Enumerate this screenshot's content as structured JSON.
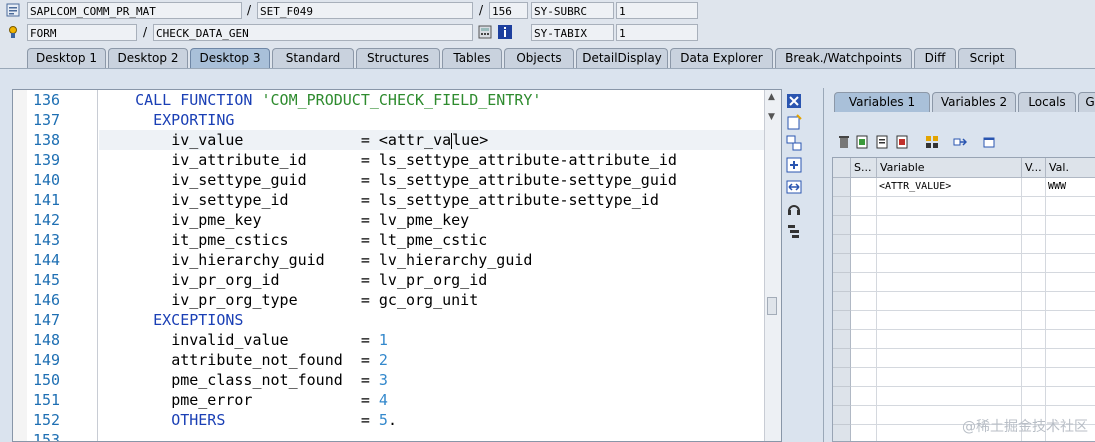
{
  "header": {
    "row1": {
      "program": "SAPLCOM_COMM_PR_MAT",
      "include": "SET_F049",
      "line": "156",
      "var1_name": "SY-SUBRC",
      "var1_value": "1"
    },
    "row2": {
      "event_type": "FORM",
      "event_name": "CHECK_DATA_GEN",
      "var2_name": "SY-TABIX",
      "var2_value": "1"
    },
    "separator": "/"
  },
  "tabs": [
    "Desktop 1",
    "Desktop 2",
    "Desktop 3",
    "Standard",
    "Structures",
    "Tables",
    "Objects",
    "DetailDisplay",
    "Data Explorer",
    "Break./Watchpoints",
    "Diff",
    "Script"
  ],
  "active_tab": "Desktop 3",
  "code": {
    "current_line": "138",
    "lines": [
      {
        "n": "136",
        "parts": [
          {
            "t": "CALL FUNCTION ",
            "c": "kw"
          },
          {
            "t": "'COM_PRODUCT_CHECK_FIELD_ENTRY'",
            "c": "str"
          }
        ],
        "indent": "  "
      },
      {
        "n": "137",
        "parts": [
          {
            "t": "EXPORTING",
            "c": "kw"
          }
        ],
        "indent": "    "
      },
      {
        "n": "138",
        "parts": [
          {
            "t": "iv_value             = <attr_va",
            "c": ""
          },
          {
            "t": "|",
            "c": "cursor"
          },
          {
            "t": "lue>",
            "c": ""
          }
        ],
        "indent": "      "
      },
      {
        "n": "139",
        "parts": [
          {
            "t": "iv_attribute_id      = ls_settype_attribute-attribute_id",
            "c": ""
          }
        ],
        "indent": "      "
      },
      {
        "n": "140",
        "parts": [
          {
            "t": "iv_settype_guid      = ls_settype_attribute-settype_guid",
            "c": ""
          }
        ],
        "indent": "      "
      },
      {
        "n": "141",
        "parts": [
          {
            "t": "iv_settype_id        = ls_settype_attribute-settype_id",
            "c": ""
          }
        ],
        "indent": "      "
      },
      {
        "n": "142",
        "parts": [
          {
            "t": "iv_pme_key           = lv_pme_key",
            "c": ""
          }
        ],
        "indent": "      "
      },
      {
        "n": "143",
        "parts": [
          {
            "t": "it_pme_cstics        = lt_pme_cstic",
            "c": ""
          }
        ],
        "indent": "      "
      },
      {
        "n": "144",
        "parts": [
          {
            "t": "iv_hierarchy_guid    = lv_hierarchy_guid",
            "c": ""
          }
        ],
        "indent": "      "
      },
      {
        "n": "145",
        "parts": [
          {
            "t": "iv_pr_org_id         = lv_pr_org_id",
            "c": ""
          }
        ],
        "indent": "      "
      },
      {
        "n": "146",
        "parts": [
          {
            "t": "iv_pr_org_type       = gc_org_unit",
            "c": ""
          }
        ],
        "indent": "      "
      },
      {
        "n": "147",
        "parts": [
          {
            "t": "EXCEPTIONS",
            "c": "kw"
          }
        ],
        "indent": "    "
      },
      {
        "n": "148",
        "parts": [
          {
            "t": "invalid_value        = ",
            "c": ""
          },
          {
            "t": "1",
            "c": "num"
          }
        ],
        "indent": "      "
      },
      {
        "n": "149",
        "parts": [
          {
            "t": "attribute_not_found  = ",
            "c": ""
          },
          {
            "t": "2",
            "c": "num"
          }
        ],
        "indent": "      "
      },
      {
        "n": "150",
        "parts": [
          {
            "t": "pme_class_not_found  = ",
            "c": ""
          },
          {
            "t": "3",
            "c": "num"
          }
        ],
        "indent": "      "
      },
      {
        "n": "151",
        "parts": [
          {
            "t": "pme_error            = ",
            "c": ""
          },
          {
            "t": "4",
            "c": "num"
          }
        ],
        "indent": "      "
      },
      {
        "n": "152",
        "parts": [
          {
            "t": "OTHERS",
            "c": "kw"
          },
          {
            "t": "               = ",
            "c": ""
          },
          {
            "t": "5",
            "c": "num"
          },
          {
            "t": ".",
            "c": ""
          }
        ],
        "indent": "      "
      },
      {
        "n": "153",
        "parts": [],
        "indent": ""
      }
    ]
  },
  "right_panel": {
    "tabs": [
      "Variables 1",
      "Variables 2",
      "Locals",
      "G"
    ],
    "active_tab": "Variables 1",
    "columns": [
      "S...",
      "Variable",
      "V...",
      "Val."
    ],
    "rows": [
      {
        "variable": "<ATTR_VALUE>",
        "value": "WWW"
      }
    ]
  },
  "watermark": "@稀土掘金技术社区",
  "colors": {
    "keyword": "#1a3fb5",
    "string": "#2e8b2e",
    "number": "#3388cc",
    "line_number": "#1e6fb3"
  }
}
